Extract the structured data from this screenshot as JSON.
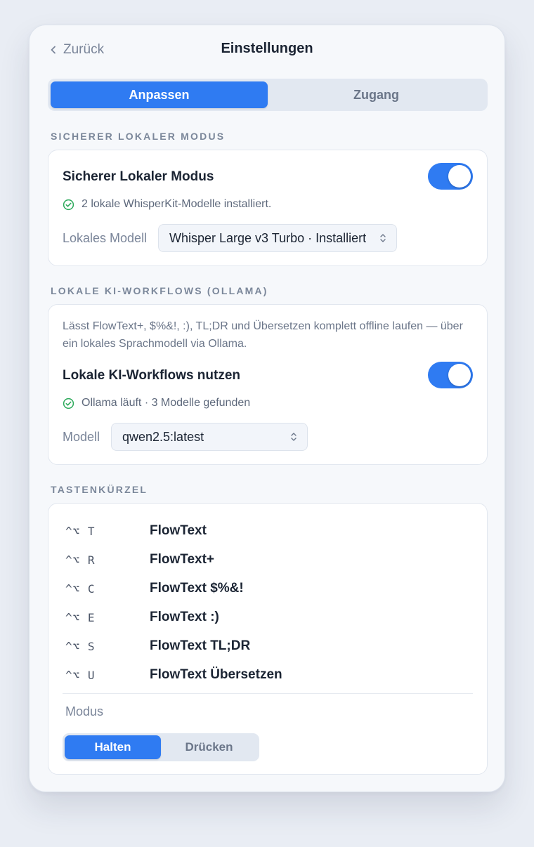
{
  "header": {
    "back_label": "Zurück",
    "title": "Einstellungen"
  },
  "main_tabs": [
    {
      "label": "Anpassen",
      "active": true
    },
    {
      "label": "Zugang",
      "active": false
    }
  ],
  "secure_local": {
    "section_label": "SICHERER LOKALER MODUS",
    "title": "Sicherer Lokaler Modus",
    "toggle_on": true,
    "status_text": "2 lokale WhisperKit-Modelle installiert.",
    "model_label": "Lokales Modell",
    "model_value": "Whisper Large v3 Turbo · Installiert"
  },
  "ollama": {
    "section_label": "LOKALE KI-WORKFLOWS (OLLAMA)",
    "description": "Lässt FlowText+, $%&!, :), TL;DR und Übersetzen komplett offline laufen — über ein lokales Sprachmodell via Ollama.",
    "title": "Lokale KI-Workflows nutzen",
    "toggle_on": true,
    "status_text": "Ollama läuft · 3 Modelle gefunden",
    "model_label": "Modell",
    "model_value": "qwen2.5:latest"
  },
  "shortcuts": {
    "section_label": "TASTENKÜRZEL",
    "items": [
      {
        "keys": "^⌥ T",
        "name": "FlowText"
      },
      {
        "keys": "^⌥ R",
        "name": "FlowText+"
      },
      {
        "keys": "^⌥ C",
        "name": "FlowText $%&!"
      },
      {
        "keys": "^⌥ E",
        "name": "FlowText :)"
      },
      {
        "keys": "^⌥ S",
        "name": "FlowText TL;DR"
      },
      {
        "keys": "^⌥ U",
        "name": "FlowText Übersetzen"
      }
    ],
    "mode_label": "Modus",
    "mode_options": [
      {
        "label": "Halten",
        "active": true
      },
      {
        "label": "Drücken",
        "active": false
      }
    ]
  },
  "colors": {
    "accent": "#2f7bf2",
    "success": "#2eaa5c"
  },
  "icons": {
    "back": "chevron-left-icon",
    "status": "check-circle-icon",
    "select": "chevron-up-down-icon"
  }
}
